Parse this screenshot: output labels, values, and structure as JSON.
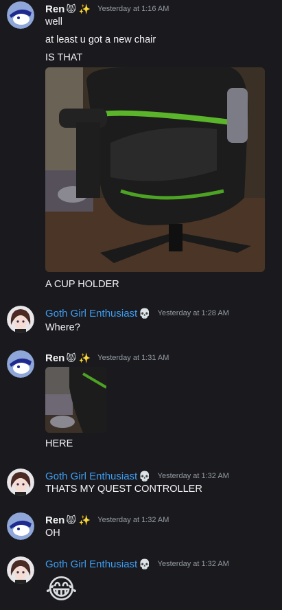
{
  "users": {
    "ren": {
      "name": "Ren",
      "badges": "😾 ✨"
    },
    "goth": {
      "name": "Goth Girl Enthusiast",
      "badges": "💀"
    }
  },
  "messages": [
    {
      "id": "m1",
      "author": "ren",
      "timestamp": "Yesterday at 1:16 AM",
      "lines": [
        "well",
        "at least u got a new chair",
        "IS THAT",
        "A CUP HOLDER"
      ]
    },
    {
      "id": "m2",
      "author": "goth",
      "timestamp": "Yesterday at 1:28 AM",
      "lines": [
        "Where?"
      ]
    },
    {
      "id": "m3",
      "author": "ren",
      "timestamp": "Yesterday at 1:31 AM",
      "lines": [
        "HERE"
      ]
    },
    {
      "id": "m4",
      "author": "goth",
      "timestamp": "Yesterday at 1:32 AM",
      "lines": [
        "THATS MY QUEST CONTROLLER"
      ]
    },
    {
      "id": "m5",
      "author": "ren",
      "timestamp": "Yesterday at 1:32 AM",
      "lines": [
        "OH"
      ]
    },
    {
      "id": "m6",
      "author": "goth",
      "timestamp": "Yesterday at 1:32 AM",
      "lines": [
        "😂"
      ]
    }
  ],
  "colors": {
    "background": "#1a1a1e",
    "username_goth": "#3e9cf0",
    "timestamp": "#949ba4"
  }
}
